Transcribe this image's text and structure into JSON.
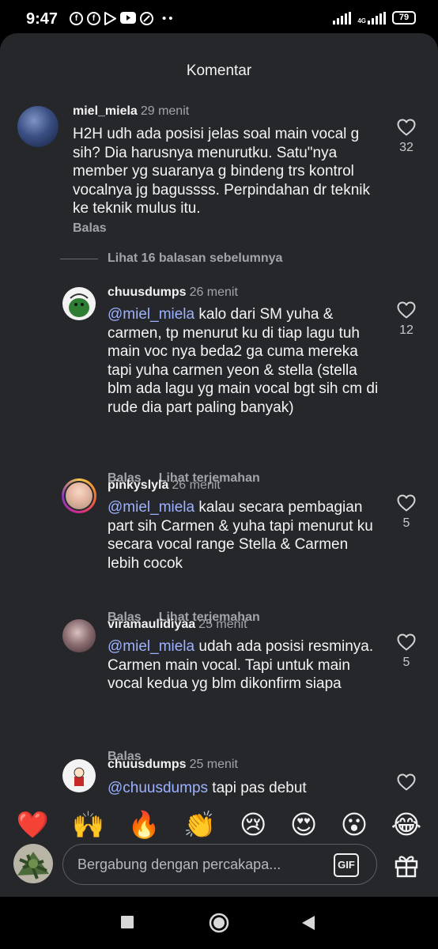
{
  "status_bar": {
    "time": "9:47",
    "left_icons": [
      "facebook-icon",
      "facebook-icon",
      "play-store-icon",
      "youtube-icon",
      "browser-icon",
      "more-dots-icon"
    ],
    "network_label": "4G",
    "battery": "79"
  },
  "sheet": {
    "title": "Komentar"
  },
  "comments": [
    {
      "username": "miel_miela",
      "time": "29 menit",
      "mention": "",
      "text": "H2H udh ada posisi jelas soal main vocal g sih? Dia harusnya menurutku. Satu\"nya member yg suaranya g bindeng trs kontrol vocalnya jg bagussss. Perpindahan dr teknik ke teknik mulus itu.",
      "reply_label": "Balas",
      "translate_label": "",
      "likes": "32"
    },
    {
      "username": "chuusdumps",
      "time": "26 menit",
      "mention": "@miel_miela",
      "text": " kalo dari SM yuha & carmen, tp menurut ku di tiap lagu tuh main voc nya beda2 ga cuma mereka tapi yuha carmen yeon & stella (stella blm ada lagu yg main vocal bgt sih cm di rude dia part paling banyak)",
      "reply_label": "Balas",
      "translate_label": "Lihat terjemahan",
      "likes": "12"
    },
    {
      "username": "pinkyslyla",
      "time": "26 menit",
      "mention": "@miel_miela",
      "text": " kalau secara pembagian part sih Carmen & yuha tapi menurut ku secara vocal range Stella & Carmen lebih cocok",
      "reply_label": "Balas",
      "translate_label": "Lihat terjemahan",
      "likes": "5"
    },
    {
      "username": "viramaulidiyaa",
      "time": "25 menit",
      "mention": "@miel_miela",
      "text": " udah ada posisi resminya. Carmen main vocal. Tapi untuk main vocal kedua yg blm dikonfirm siapa",
      "reply_label": "Balas",
      "translate_label": "",
      "likes": "5"
    },
    {
      "username": "chuusdumps",
      "time": "25 menit",
      "mention": "@chuusdumps",
      "text": " tapi pas debut",
      "reply_label": "",
      "translate_label": "",
      "likes": ""
    }
  ],
  "view_more_replies": "Lihat 16 balasan sebelumnya",
  "emoji_reactions": [
    "❤️",
    "🙌",
    "🔥",
    "👏",
    "😢",
    "😍",
    "😮",
    "😂"
  ],
  "composer": {
    "placeholder": "Bergabung dengan percakapa...",
    "gif_label": "GIF"
  },
  "colors": {
    "sheet_background": "#26272b",
    "mention": "#9db2ff",
    "secondary_text": "#a3a4a8"
  }
}
